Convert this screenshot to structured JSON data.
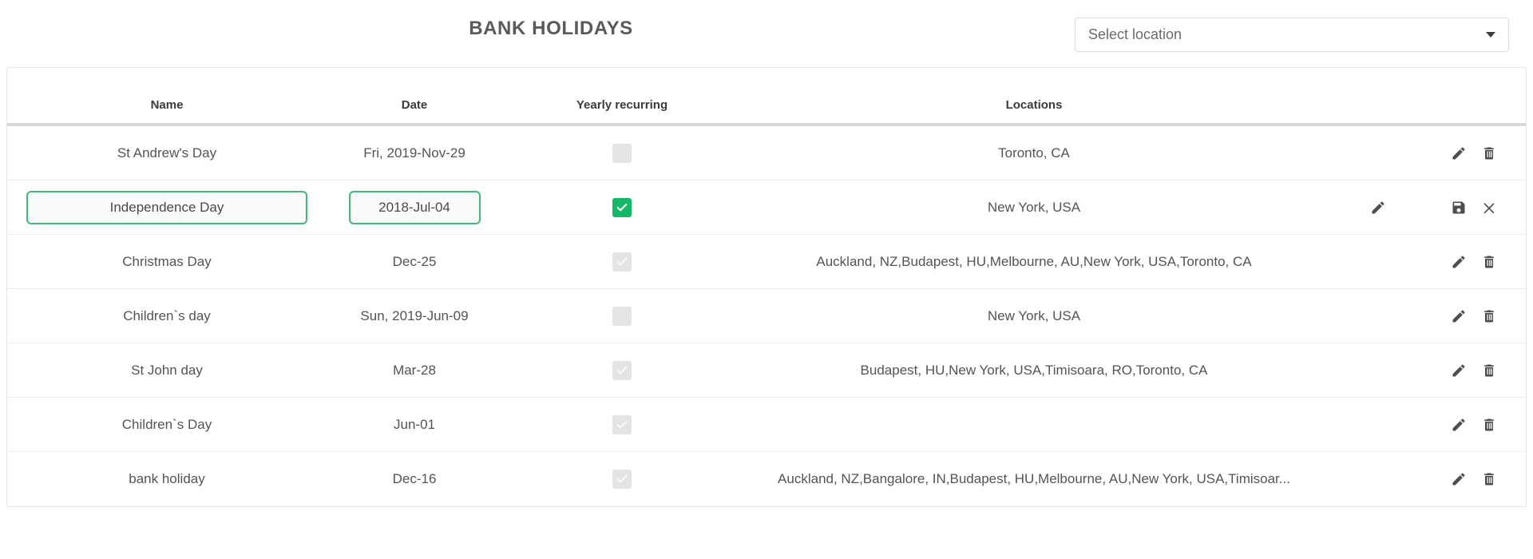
{
  "header": {
    "title": "BANK HOLIDAYS",
    "location_select": {
      "placeholder": "Select location",
      "value": "",
      "caret_icon": "chevron-down-icon"
    }
  },
  "table": {
    "columns": [
      "Name",
      "Date",
      "Yearly recurring",
      "Locations"
    ],
    "rows": [
      {
        "name": "St Andrew's Day",
        "date": "Fri, 2019-Nov-29",
        "yearly_recurring": false,
        "recurring_state": "unchecked-disabled",
        "locations": "Toronto, CA",
        "editing": false,
        "actions": [
          "edit-icon",
          "delete-icon"
        ]
      },
      {
        "name": "Independence Day",
        "date": "2018-Jul-04",
        "yearly_recurring": true,
        "recurring_state": "checked-active",
        "locations": "New York, USA",
        "editing": true,
        "actions": [
          "save-icon",
          "cancel-icon"
        ],
        "location_edit_icon": "edit-icon"
      },
      {
        "name": "Christmas Day",
        "date": "Dec-25",
        "yearly_recurring": true,
        "recurring_state": "checked-disabled",
        "locations": "Auckland, NZ,Budapest, HU,Melbourne, AU,New York, USA,Toronto, CA",
        "editing": false,
        "actions": [
          "edit-icon",
          "delete-icon"
        ]
      },
      {
        "name": "Children`s day",
        "date": "Sun, 2019-Jun-09",
        "yearly_recurring": false,
        "recurring_state": "unchecked-disabled",
        "locations": "New York, USA",
        "editing": false,
        "actions": [
          "edit-icon",
          "delete-icon"
        ]
      },
      {
        "name": "St John day",
        "date": "Mar-28",
        "yearly_recurring": true,
        "recurring_state": "checked-disabled",
        "locations": "Budapest, HU,New York, USA,Timisoara, RO,Toronto, CA",
        "editing": false,
        "actions": [
          "edit-icon",
          "delete-icon"
        ]
      },
      {
        "name": "Children`s Day",
        "date": "Jun-01",
        "yearly_recurring": true,
        "recurring_state": "checked-disabled",
        "locations": "",
        "editing": false,
        "actions": [
          "edit-icon",
          "delete-icon"
        ]
      },
      {
        "name": "bank holiday",
        "date": "Dec-16",
        "yearly_recurring": true,
        "recurring_state": "checked-disabled",
        "locations": "Auckland, NZ,Bangalore, IN,Budapest, HU,Melbourne, AU,New York, USA,Timisoar...",
        "editing": false,
        "actions": [
          "edit-icon",
          "delete-icon"
        ]
      }
    ]
  },
  "colors": {
    "accent_green": "#14b866",
    "input_border_green": "#45b77d",
    "text": "#545454",
    "header_text": "#3b3b3b",
    "divider": "#d8d8d8",
    "checkbox_disabled": "#e4e4e4"
  }
}
